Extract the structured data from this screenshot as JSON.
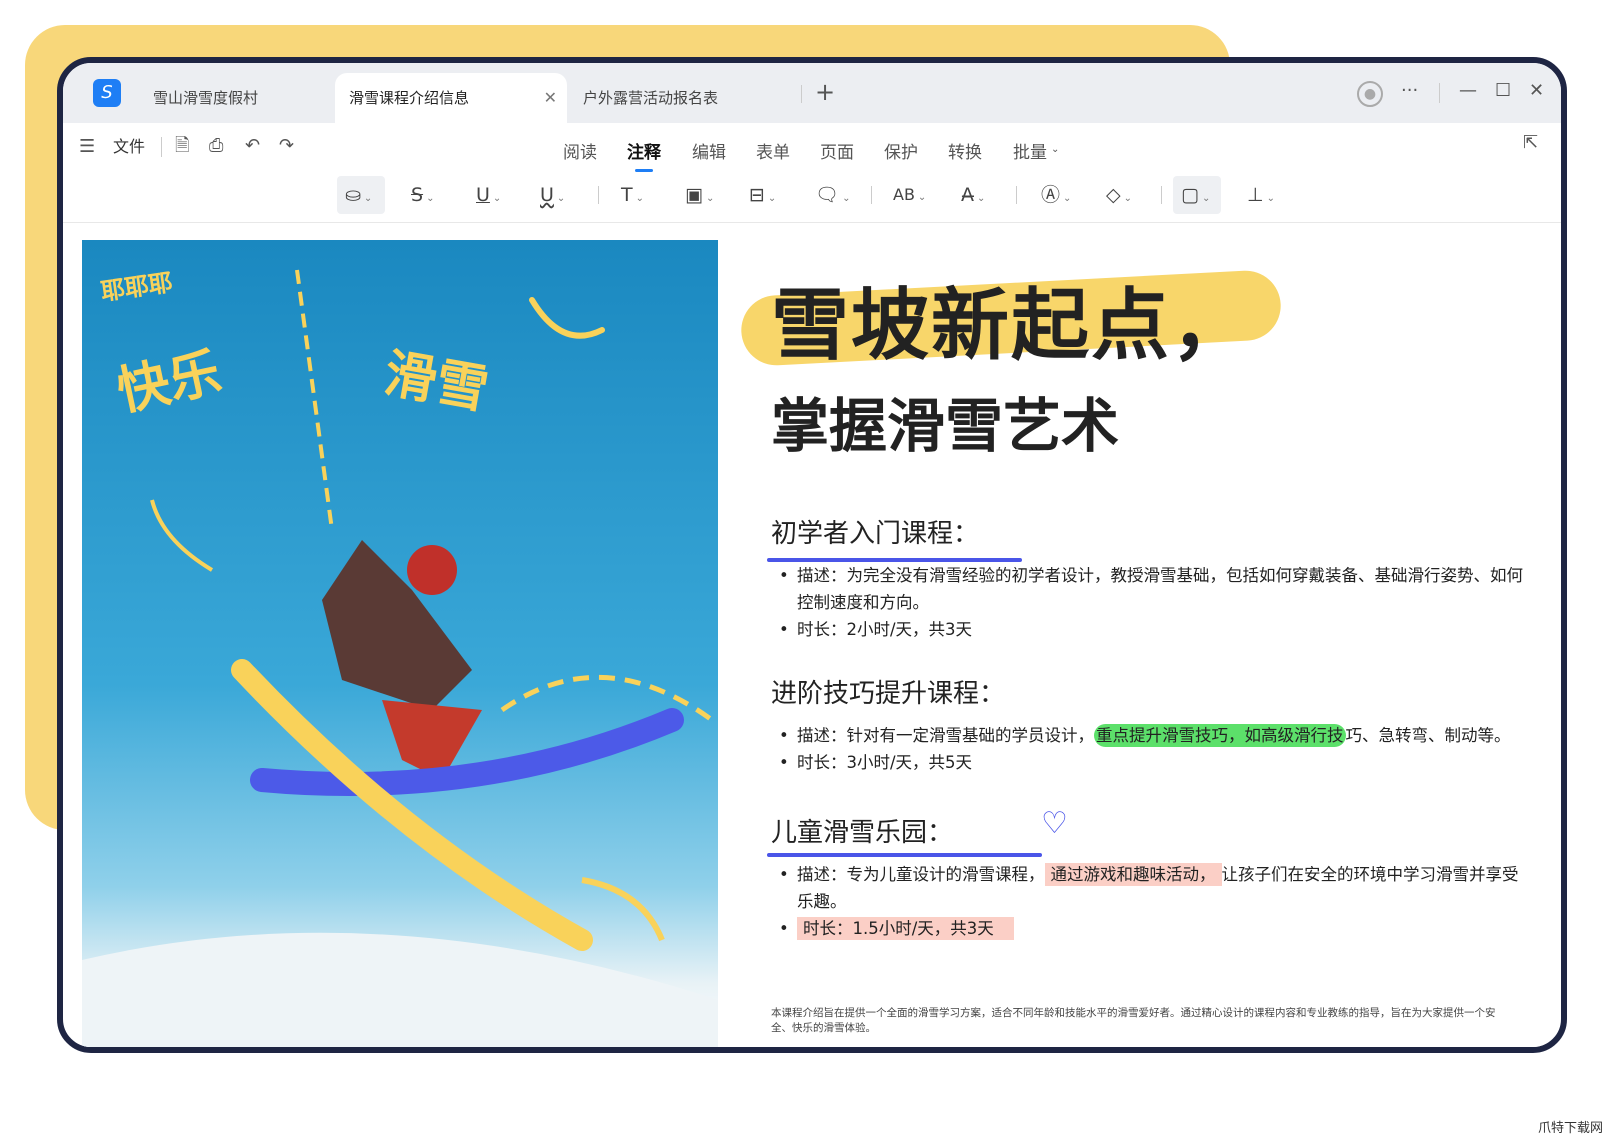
{
  "tabs": [
    {
      "label": "雪山滑雪度假村"
    },
    {
      "label": "滑雪课程介绍信息",
      "active": true
    },
    {
      "label": "户外露营活动报名表"
    }
  ],
  "file_menu": "文件",
  "menus": [
    "阅读",
    "注释",
    "编辑",
    "表单",
    "页面",
    "保护",
    "转换",
    "批量"
  ],
  "document": {
    "title_line1": "雪坡新起点，",
    "title_line2": "掌握滑雪艺术",
    "photo_doodles": [
      "耶耶耶",
      "快乐",
      "滑雪"
    ],
    "sections": [
      {
        "heading": "初学者入门课程：",
        "desc_label": "描述：",
        "desc": "为完全没有滑雪经验的初学者设计，教授滑雪基础，包括如何穿戴装备、基础滑行姿势、如何控制速度和方向。",
        "duration": "时长：2小时/天，共3天"
      },
      {
        "heading": "进阶技巧提升课程：",
        "desc_label": "描述：",
        "desc_pre": "针对有一定滑雪基础的学员设计，",
        "desc_hl": "重点提升滑雪技巧，如高级滑行技",
        "desc_post": "巧、急转弯、制动等。",
        "duration": "时长：3小时/天，共5天"
      },
      {
        "heading": "儿童滑雪乐园：",
        "desc_label": "描述：",
        "desc_pre": "专为儿童设计的滑雪课程，",
        "desc_hl": "通过游戏和趣味活动，",
        "desc_post": "让孩子们在安全的环境中学习滑雪并享受乐趣。",
        "duration": "时长：1.5小时/天，共3天"
      }
    ],
    "footnote": "本课程介绍旨在提供一个全面的滑雪学习方案，适合不同年龄和技能水平的滑雪爱好者。通过精心设计的课程内容和专业教练的指导，旨在为大家提供一个安全、快乐的滑雪体验。"
  },
  "watermark": "爪特下载网"
}
